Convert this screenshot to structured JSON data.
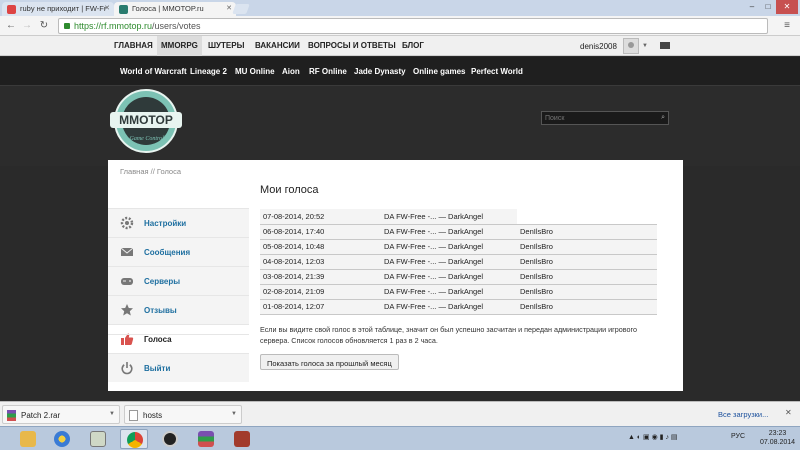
{
  "browser": {
    "tabs": [
      {
        "title": "ruby не приходит | FW-Fr",
        "active": false
      },
      {
        "title": "Голоса | MMOTOP.ru",
        "active": true
      }
    ],
    "url_host": "https://rf.mmotop.ru",
    "url_path": "/users/votes"
  },
  "site": {
    "topnav": [
      "ГЛАВНАЯ",
      "MMORPG",
      "ШУТЕРЫ",
      "ВАКАНСИИ",
      "ВОПРОСЫ И ОТВЕТЫ",
      "БЛОГ"
    ],
    "active_topnav": "MMORPG",
    "username": "denis2008",
    "gamenav": [
      "World of Warcraft",
      "Lineage 2",
      "MU Online",
      "Aion",
      "RF Online",
      "Jade Dynasty",
      "Online games",
      "Perfect World"
    ],
    "logo_text": "MMOTOP",
    "logo_subtext": "Game Controller",
    "search_placeholder": "Поиск"
  },
  "breadcrumb": "Главная // Голоса",
  "sidebar": [
    {
      "label": "Настройки",
      "icon": "gear-icon"
    },
    {
      "label": "Сообщения",
      "icon": "envelope-icon"
    },
    {
      "label": "Серверы",
      "icon": "gamepad-icon"
    },
    {
      "label": "Отзывы",
      "icon": "star-icon"
    },
    {
      "label": "Голоса",
      "icon": "thumbs-up-icon",
      "active": true
    },
    {
      "label": "Выйти",
      "icon": "power-icon"
    }
  ],
  "page_title": "Мои голоса",
  "votes": [
    {
      "date": "07-08-2014, 20:52",
      "server": "DA FW-Free -... — DarkAngel",
      "nick": ""
    },
    {
      "date": "06-08-2014, 17:40",
      "server": "DA FW-Free -... — DarkAngel",
      "nick": "DenIlsBro"
    },
    {
      "date": "05-08-2014, 10:48",
      "server": "DA FW-Free -... — DarkAngel",
      "nick": "DenIlsBro"
    },
    {
      "date": "04-08-2014, 12:03",
      "server": "DA FW-Free -... — DarkAngel",
      "nick": "DenIlsBro"
    },
    {
      "date": "03-08-2014, 21:39",
      "server": "DA FW-Free -... — DarkAngel",
      "nick": "DenIlsBro"
    },
    {
      "date": "02-08-2014, 21:09",
      "server": "DA FW-Free -... — DarkAngel",
      "nick": "DenIlsBro"
    },
    {
      "date": "01-08-2014, 12:07",
      "server": "DA FW-Free -... — DarkAngel",
      "nick": "DenIlsBro"
    }
  ],
  "note": "Если вы видите свой голос в этой таблице, значит он был успешно засчитан и передан администрации игрового сервера. Список голосов обновляется 1 раз в 2 часа.",
  "prev_month_button": "Показать голоса за прошлый месяц",
  "downloads": [
    {
      "name": "Patch 2.rar",
      "icon": "archive-icon"
    },
    {
      "name": "hosts",
      "icon": "file-icon"
    }
  ],
  "all_downloads": "Все загрузки...",
  "taskbar": {
    "language": "РУС",
    "time": "23:23",
    "date": "07.08.2014"
  },
  "colors": {
    "link": "#1e6fa0",
    "dark_bg": "#2a2a2a",
    "ssl_green": "#2e8b2e"
  }
}
